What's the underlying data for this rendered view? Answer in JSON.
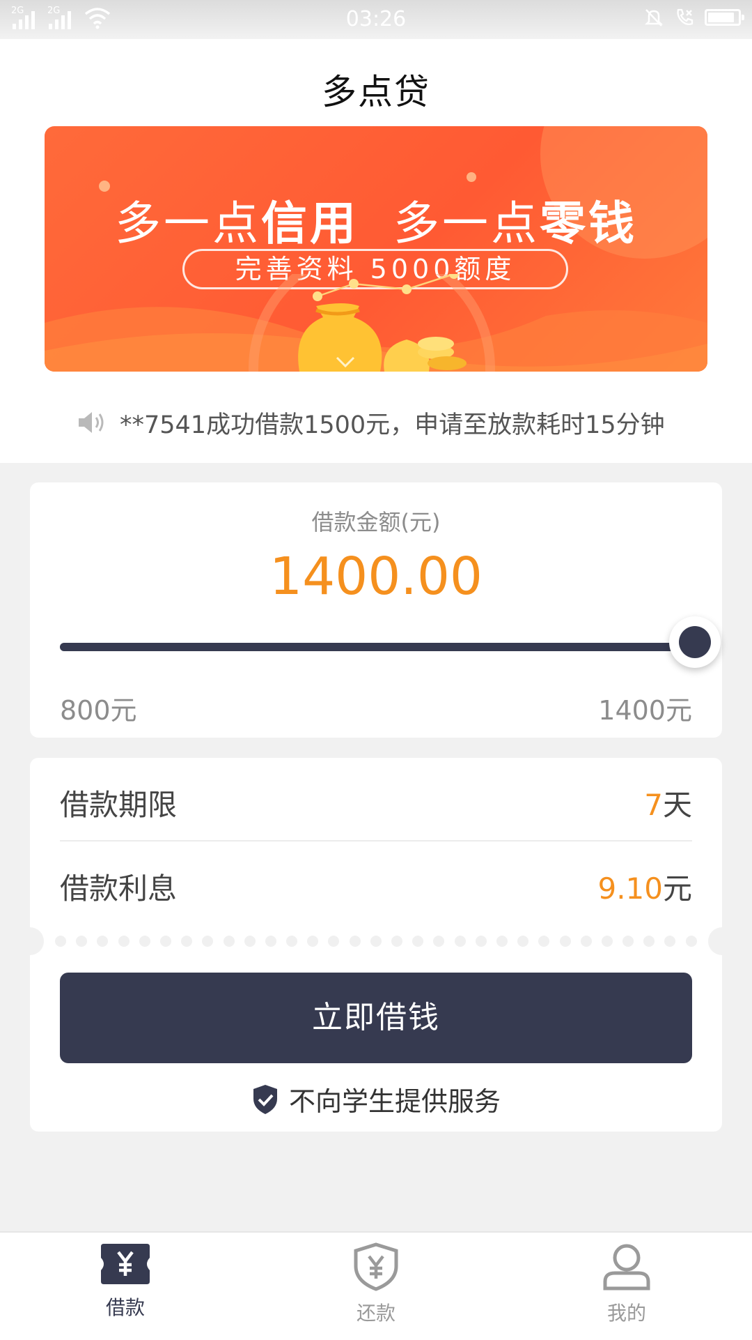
{
  "status_bar": {
    "time": "03:26",
    "sim1_network": "2G",
    "sim2_network": "2G",
    "battery_level": 0.9,
    "icons": [
      "signal-icon",
      "signal-icon",
      "wifi-icon",
      "silent-bell-icon",
      "call-icon",
      "battery-icon"
    ]
  },
  "header": {
    "title": "多点贷"
  },
  "banner": {
    "headline_part1": "多一点",
    "headline_part1_bold": "信用",
    "headline_part2": "多一点",
    "headline_part2_bold": "零钱",
    "pill_text": "完善资料 5000额度",
    "colors": {
      "background": "#ff5a33",
      "accent": "#ffc233"
    }
  },
  "notice": {
    "icon": "speaker-icon",
    "text": "**7541成功借款1500元，申请至放款耗时15分钟"
  },
  "amount": {
    "label": "借款金额(元)",
    "value": "1400.00",
    "slider_fraction": 1.0,
    "min_label": "800元",
    "max_label": "1400元"
  },
  "terms": {
    "period_label": "借款期限",
    "period_value": "7",
    "period_unit": "天",
    "interest_label": "借款利息",
    "interest_value": "9.10",
    "interest_unit": "元"
  },
  "actions": {
    "borrow_button": "立即借钱",
    "student_notice": "不向学生提供服务",
    "student_notice_icon": "shield-check-icon"
  },
  "bottom_nav": {
    "items": [
      {
        "label": "借款",
        "icon": "loan-ticket-icon",
        "active": true
      },
      {
        "label": "还款",
        "icon": "repay-shield-icon",
        "active": false
      },
      {
        "label": "我的",
        "icon": "user-icon",
        "active": false
      }
    ]
  },
  "colors": {
    "accent_orange": "#f5901e",
    "primary_dark": "#363a50",
    "background": "#f1f1f1"
  }
}
